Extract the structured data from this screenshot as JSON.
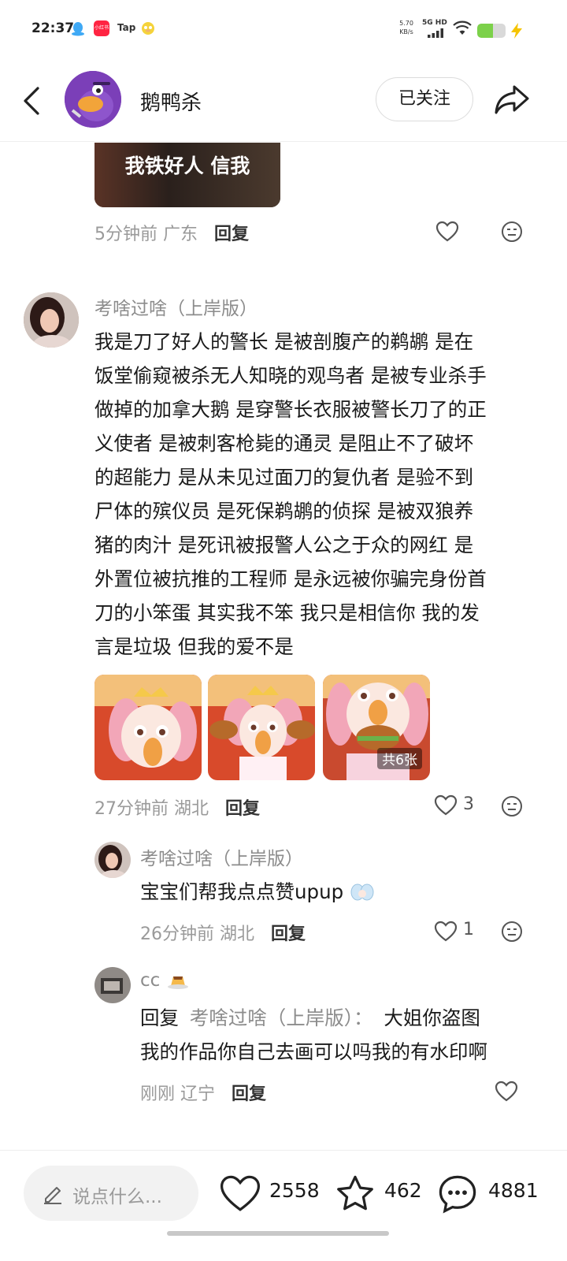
{
  "status_bar": {
    "time": "22:37",
    "net_speed_value": "5.70",
    "net_speed_unit": "KB/s",
    "network": "5G HD",
    "battery_level": 0.55,
    "app_icons": [
      "qq-icon",
      "xiaohongshu-icon",
      "taptap-icon",
      "psyduck-icon"
    ],
    "app_icon_labels": {
      "taptap": "Tap",
      "xiaohongshu": "小红书"
    }
  },
  "header": {
    "title": "鹅鸭杀",
    "follow_label": "已关注"
  },
  "top_reply": {
    "image_text": "我铁好人 信我",
    "time": "5分钟前",
    "location": "广东",
    "reply_label": "回复"
  },
  "comment": {
    "username": "考啥过啥（上岸版）",
    "body_lines": [
      "我是刀了好人的警长 是被剖腹产的鹈鹕 是在",
      "饭堂偷窥被杀无人知晓的观鸟者 是被专业杀手",
      "做掉的加拿大鹅 是穿警长衣服被警长刀了的正",
      "义使者 是被刺客枪毙的通灵 是阻止不了破坏",
      "的超能力 是从未见过面刀的复仇者 是验不到",
      "尸体的殡仪员 是死保鹈鹕的侦探 是被双狼养",
      "猪的肉汁 是死讯被报警人公之于众的网红 是",
      "外置位被抗推的工程师 是永远被你骗完身份首",
      "刀的小笨蛋 其实我不笨 我只是相信你 我的发",
      "言是垃圾 但我的爱不是"
    ],
    "image_count_label": "共6张",
    "time": "27分钟前",
    "location": "湖北",
    "reply_label": "回复",
    "like_count": "3"
  },
  "reply1": {
    "username": "考啥过啥（上岸版）",
    "body": "宝宝们帮我点点赞upup",
    "time": "26分钟前",
    "location": "湖北",
    "reply_label": "回复",
    "like_count": "1"
  },
  "reply2": {
    "username": "cc",
    "reply_prefix": "回复",
    "reply_to": "考啥过啥（上岸版）：",
    "body_line1": "大姐你盗图",
    "body_line2": "我的作品你自己去画可以吗我的有水印啊",
    "time": "刚刚",
    "location": "辽宁",
    "reply_label": "回复"
  },
  "bottom_bar": {
    "input_placeholder": "说点什么...",
    "likes": "2558",
    "favorites": "462",
    "comments": "4881"
  },
  "colors": {
    "accent_green": "#7cd14a",
    "text_primary": "#1a1a1a",
    "text_secondary": "#9a9a9a"
  }
}
